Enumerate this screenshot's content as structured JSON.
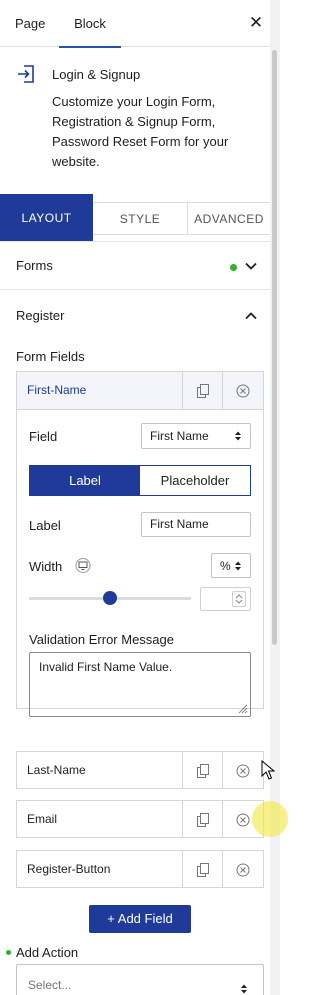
{
  "top_tabs": {
    "page": "Page",
    "block": "Block"
  },
  "block_card": {
    "title": "Login & Signup",
    "description": "Customize your Login Form, Registration & Signup Form, Password Reset Form for your website."
  },
  "mode_tabs": {
    "layout": "LAYOUT",
    "style": "STYLE",
    "advanced": "ADVANCED"
  },
  "panels": {
    "forms": "Forms",
    "register": "Register",
    "form_fields_label": "Form Fields"
  },
  "first_name_field": {
    "name": "First-Name",
    "field_label": "Field",
    "field_value": "First Name",
    "label_toggle_on": "Label",
    "label_toggle_off": "Placeholder",
    "label_label": "Label",
    "label_value": "First Name",
    "width_label": "Width",
    "width_unit": "%",
    "width_level": 0.5,
    "validation_label": "Validation Error Message",
    "validation_value": "Invalid First Name Value."
  },
  "fields": [
    {
      "name": "Last-Name"
    },
    {
      "name": "Email"
    },
    {
      "name": "Register-Button"
    }
  ],
  "add_field_label": "+ Add Field",
  "add_action": {
    "label": "Add Action",
    "placeholder": "Select..."
  },
  "colors": {
    "primary": "#1f3a99",
    "active_dot": "#2bb52b"
  }
}
